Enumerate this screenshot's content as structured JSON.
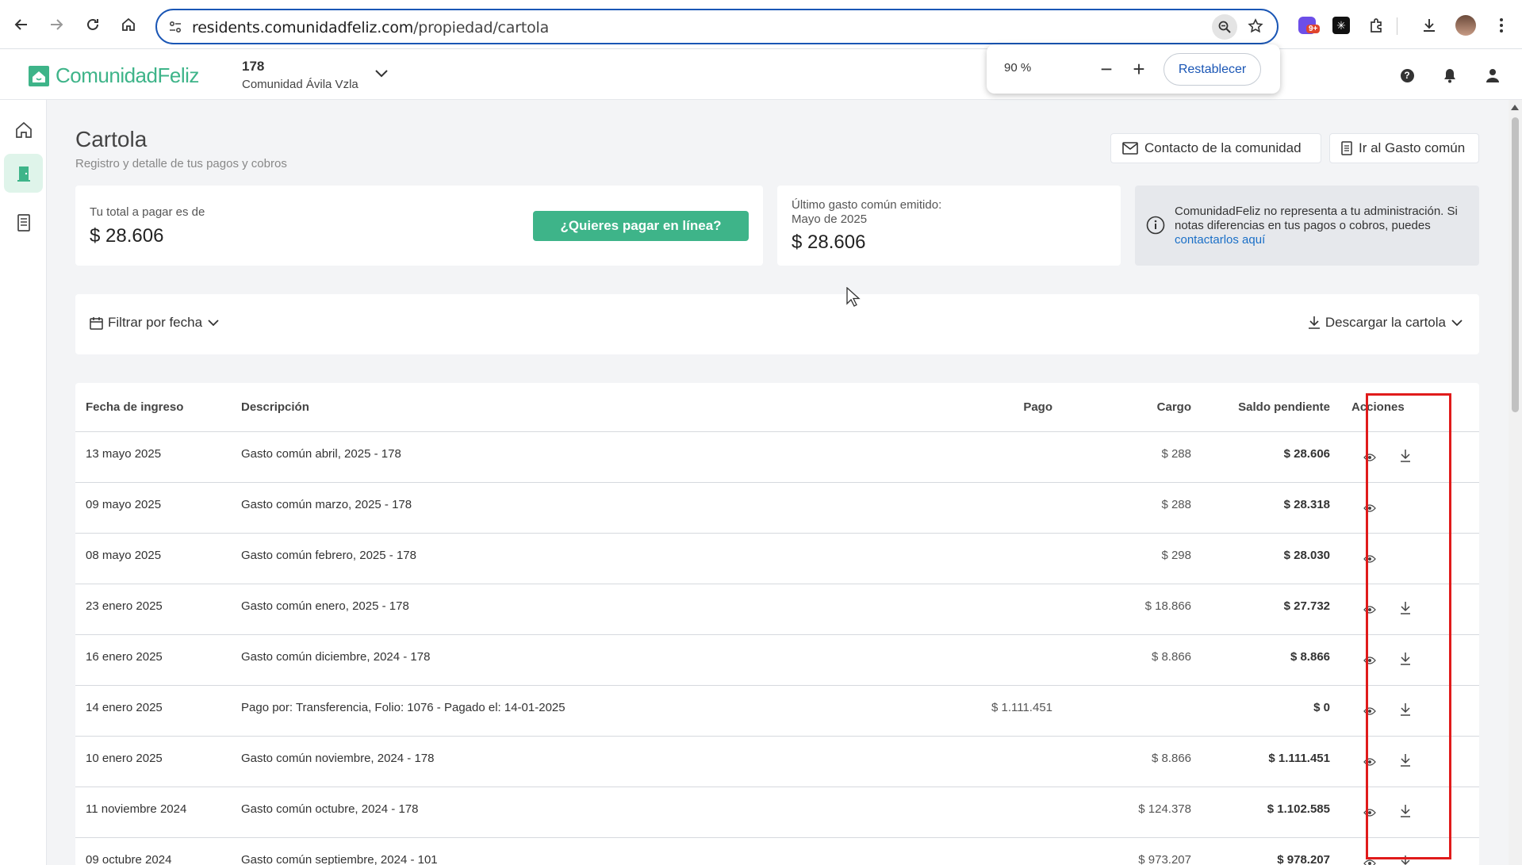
{
  "browser": {
    "url_host": "residents.comunidadfeliz.com",
    "url_path": "/propiedad/cartola",
    "extension_badge": "9+"
  },
  "zoom_popup": {
    "value": "90 %",
    "minus": "−",
    "plus": "+",
    "reset_label": "Restablecer"
  },
  "header": {
    "logo_text": "ComunidadFeliz",
    "unit_number": "178",
    "community_name": "Comunidad Ávila Vzla"
  },
  "page": {
    "title": "Cartola",
    "subtitle": "Registro y detalle de tus pagos y cobros",
    "contact_button": "Contacto de la comunidad",
    "common_expense_button": "Ir al Gasto común"
  },
  "summary": {
    "total_label": "Tu total a pagar es de",
    "total_amount": "$ 28.606",
    "pay_online_button": "¿Quieres pagar en línea?",
    "last_expense_label": "Último gasto común emitido:",
    "last_expense_month": "Mayo de 2025",
    "last_expense_amount": "$ 28.606",
    "info_text": "ComunidadFeliz no representa a tu administración. Si notas diferencias en tus pagos o cobros, puedes",
    "info_link": "contactarlos aquí"
  },
  "filters": {
    "date_filter": "Filtrar por fecha",
    "download": "Descargar la cartola"
  },
  "table": {
    "headers": {
      "date": "Fecha de ingreso",
      "description": "Descripción",
      "payment": "Pago",
      "charge": "Cargo",
      "balance": "Saldo pendiente",
      "actions": "Acciones"
    },
    "rows": [
      {
        "date": "13 mayo 2025",
        "description": "Gasto común abril, 2025 - 178",
        "payment": "",
        "charge": "$ 288",
        "balance": "$ 28.606",
        "download": true
      },
      {
        "date": "09 mayo 2025",
        "description": "Gasto común marzo, 2025 - 178",
        "payment": "",
        "charge": "$ 288",
        "balance": "$ 28.318",
        "download": false
      },
      {
        "date": "08 mayo 2025",
        "description": "Gasto común febrero, 2025 - 178",
        "payment": "",
        "charge": "$ 298",
        "balance": "$ 28.030",
        "download": false
      },
      {
        "date": "23 enero 2025",
        "description": "Gasto común enero, 2025 - 178",
        "payment": "",
        "charge": "$ 18.866",
        "balance": "$ 27.732",
        "download": true
      },
      {
        "date": "16 enero 2025",
        "description": "Gasto común diciembre, 2024 - 178",
        "payment": "",
        "charge": "$ 8.866",
        "balance": "$ 8.866",
        "download": true
      },
      {
        "date": "14 enero 2025",
        "description": "Pago por: Transferencia, Folio: 1076 - Pagado el: 14-01-2025",
        "payment": "$ 1.111.451",
        "charge": "",
        "balance": "$ 0",
        "download": true
      },
      {
        "date": "10 enero 2025",
        "description": "Gasto común noviembre, 2024 - 178",
        "payment": "",
        "charge": "$ 8.866",
        "balance": "$ 1.111.451",
        "download": true
      },
      {
        "date": "11 noviembre 2024",
        "description": "Gasto común octubre, 2024 - 178",
        "payment": "",
        "charge": "$ 124.378",
        "balance": "$ 1.102.585",
        "download": true
      },
      {
        "date": "09 octubre 2024",
        "description": "Gasto común septiembre, 2024 - 101",
        "payment": "",
        "charge": "$ 973.207",
        "balance": "$ 978.207",
        "download": true
      }
    ]
  },
  "colors": {
    "brand_green": "#3eb489",
    "link_blue": "#1a6fc7",
    "annotation_red": "#e01b1b"
  }
}
